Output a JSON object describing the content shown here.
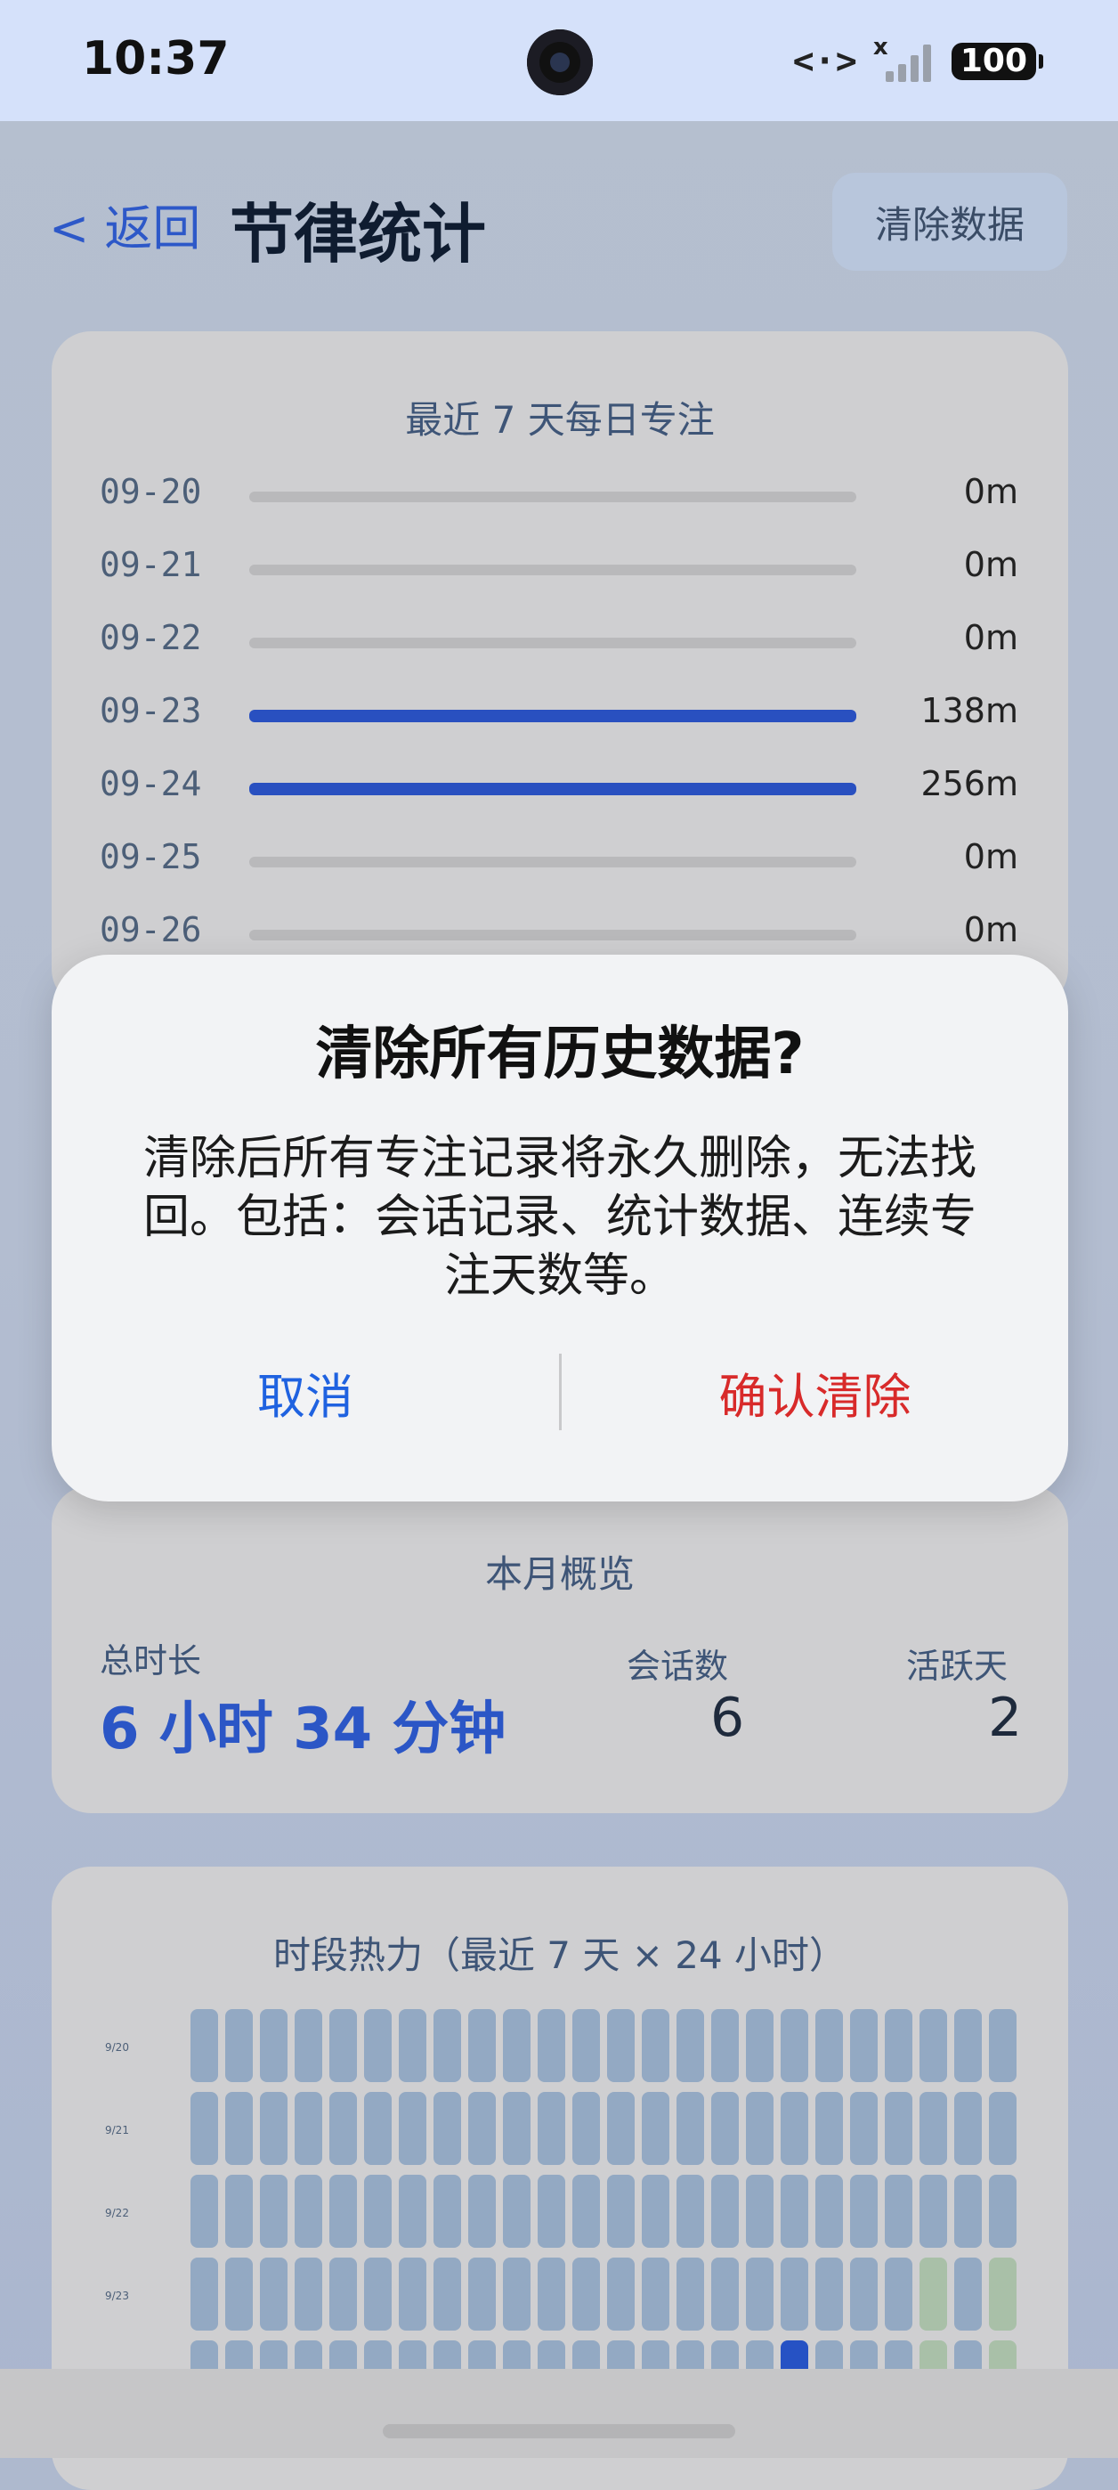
{
  "status_bar": {
    "time": "10:37",
    "net_icon": "<·>",
    "signal_x": "x",
    "battery": "100"
  },
  "header": {
    "back": "< 返回",
    "title": "节律统计",
    "clear_button": "清除数据"
  },
  "daily": {
    "title": "最近 7 天每日专注",
    "rows": [
      {
        "date": "09-20",
        "value": "0m",
        "active": false
      },
      {
        "date": "09-21",
        "value": "0m",
        "active": false
      },
      {
        "date": "09-22",
        "value": "0m",
        "active": false
      },
      {
        "date": "09-23",
        "value": "138m",
        "active": true
      },
      {
        "date": "09-24",
        "value": "256m",
        "active": true
      },
      {
        "date": "09-25",
        "value": "0m",
        "active": false
      },
      {
        "date": "09-26",
        "value": "0m",
        "active": false
      }
    ]
  },
  "dialog": {
    "title": "清除所有历史数据?",
    "message": "清除后所有专注记录将永久删除，无法找回。包括：会话记录、统计数据、连续专注天数等。",
    "cancel": "取消",
    "confirm": "确认清除"
  },
  "month": {
    "title": "本月概览",
    "total_label": "总时长",
    "total_value": "6 小时 34 分钟",
    "sessions_label": "会话数",
    "sessions_value": "6",
    "active_days_label": "活跃天",
    "active_days_value": "2"
  },
  "heatmap": {
    "title": "时段热力（最近 7 天 × 24 小时）",
    "row_labels": [
      "9/20",
      "9/21",
      "9/22",
      "9/23"
    ],
    "colors": {
      "empty": "#93a9c3",
      "light": "#a9c0a8",
      "hot": "#2652c4"
    }
  }
}
